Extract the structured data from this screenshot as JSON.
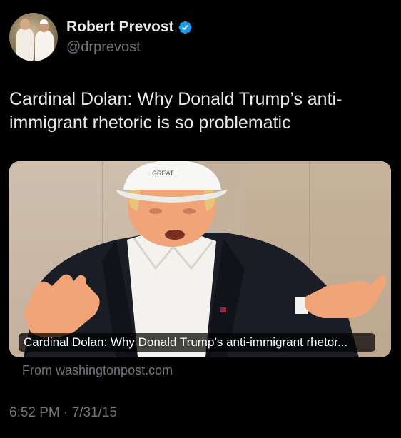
{
  "author": {
    "display_name": "Robert Prevost",
    "handle": "@drprevost",
    "verified": true,
    "avatar_icon": "profile-photo-two-clergy"
  },
  "tweet": {
    "text": "Cardinal Dolan: Why Donald Trump’s anti-immigrant rhetoric is so problematic"
  },
  "link_card": {
    "title": "Cardinal Dolan: Why Donald Trump’s anti-immigrant rhetor...",
    "source": "From washingtonpost.com",
    "image_icon": "news-photo-man-in-white-cap-gesturing"
  },
  "meta": {
    "timestamp": "6:52 PM · 7/31/15"
  },
  "colors": {
    "background": "#000000",
    "primary_text": "#e7e9ea",
    "secondary_text": "#71767b",
    "verified_badge": "#1d9bf0"
  }
}
